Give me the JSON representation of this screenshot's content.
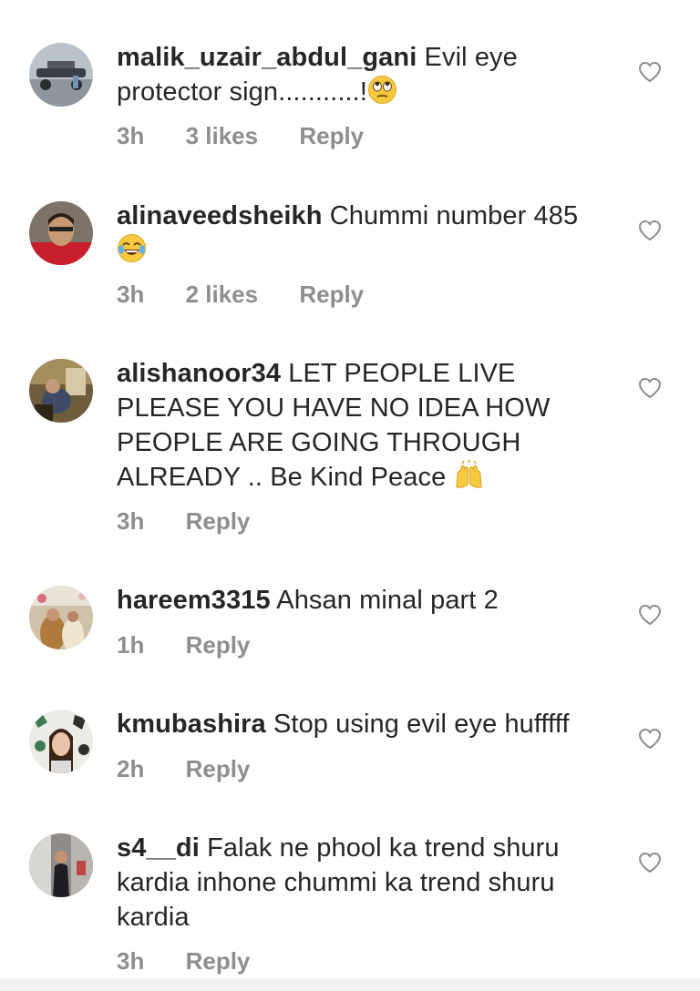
{
  "comments": [
    {
      "username": "malik_uzair_abdul_gani",
      "text": "Evil eye protector sign...........!",
      "emoji": "face-with-rolling-eyes",
      "time": "3h",
      "likes": "3 likes",
      "reply": "Reply"
    },
    {
      "username": "alinaveedsheikh",
      "text": "Chummi number 485",
      "emoji": "face-with-tears-of-joy",
      "time": "3h",
      "likes": "2 likes",
      "reply": "Reply"
    },
    {
      "username": "alishanoor34",
      "text": "LET PEOPLE LIVE PLEASE YOU HAVE NO IDEA HOW PEOPLE ARE GOING THROUGH ALREADY .. Be Kind Peace",
      "emoji": "raising-hands",
      "time": "3h",
      "reply": "Reply"
    },
    {
      "username": "hareem3315",
      "text": "Ahsan minal part 2",
      "time": "1h",
      "reply": "Reply"
    },
    {
      "username": "kmubashira",
      "text": "Stop using evil eye hufffff",
      "time": "2h",
      "reply": "Reply"
    },
    {
      "username": "s4__di",
      "text": "Falak ne phool ka trend shuru kardia inhone chummi ka trend shuru kardia",
      "time": "3h",
      "reply": "Reply"
    }
  ],
  "icons": {
    "like": "heart-outline-icon",
    "avatar": "avatar"
  },
  "colors": {
    "text": "#262626",
    "secondary": "#8e8e8e",
    "background": "#ffffff"
  }
}
